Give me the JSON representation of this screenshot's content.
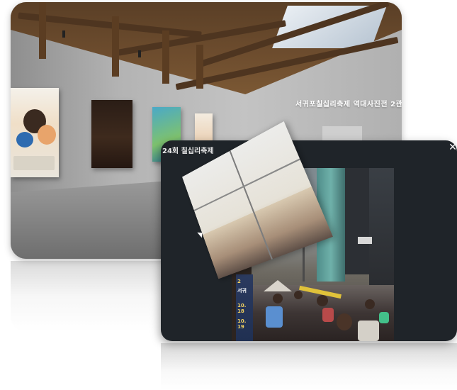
{
  "gallery": {
    "hall_title": "서귀포칠십리축제 역대사진전 2관"
  },
  "viewer": {
    "title": "24회 칠십리축제",
    "close_glyph": "✕",
    "photo_poster_lines": [
      "2",
      "서귀",
      "10. 18",
      "10. 19"
    ]
  },
  "icons": {
    "close": "close-icon",
    "pointer": "cursor-icon"
  },
  "colors": {
    "viewer_bg": "#1f2429",
    "ceiling_wood": "#5a3f26",
    "gallery_wall": "#b3b3b3"
  }
}
